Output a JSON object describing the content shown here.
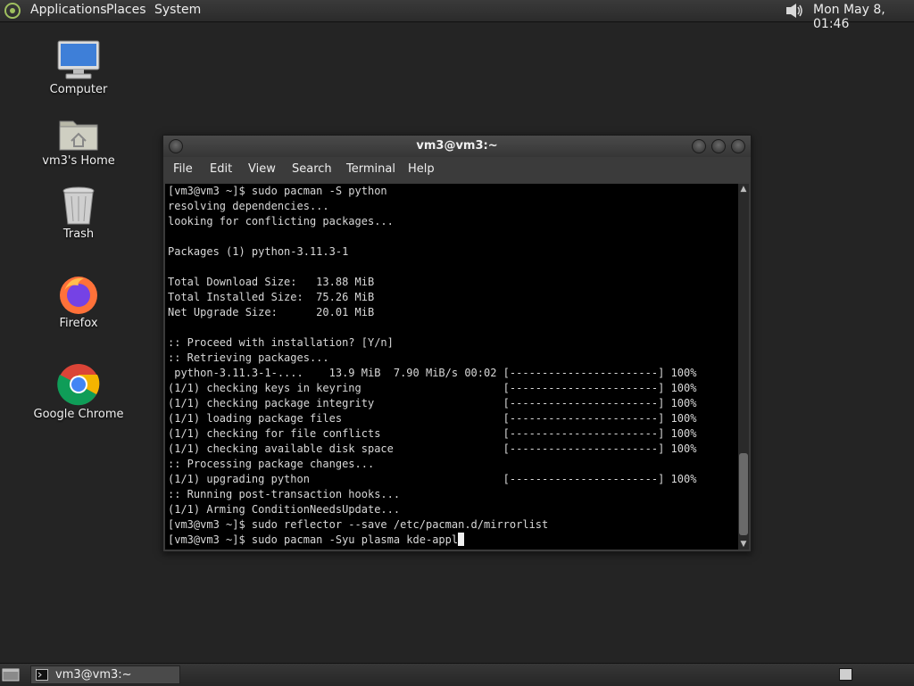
{
  "top_panel": {
    "menus": [
      "Applications",
      "Places",
      "System"
    ],
    "clock": "Mon May  8, 01:46",
    "logo_icon": "distro-logo-icon",
    "volume_icon": "volume-icon"
  },
  "desktop_icons": [
    {
      "label": "Computer",
      "icon": "computer-icon"
    },
    {
      "label": "vm3's Home",
      "icon": "home-folder-icon"
    },
    {
      "label": "Trash",
      "icon": "trash-icon"
    },
    {
      "label": "Firefox",
      "icon": "firefox-icon"
    },
    {
      "label": "Google Chrome",
      "icon": "chrome-icon"
    }
  ],
  "terminal": {
    "title": "vm3@vm3:~",
    "menu": [
      "File",
      "Edit",
      "View",
      "Search",
      "Terminal",
      "Help"
    ],
    "lines": [
      "[vm3@vm3 ~]$ sudo pacman -S python",
      "resolving dependencies...",
      "looking for conflicting packages...",
      "",
      "Packages (1) python-3.11.3-1",
      "",
      "Total Download Size:   13.88 MiB",
      "Total Installed Size:  75.26 MiB",
      "Net Upgrade Size:      20.01 MiB",
      "",
      ":: Proceed with installation? [Y/n]",
      ":: Retrieving packages...",
      " python-3.11.3-1-....    13.9 MiB  7.90 MiB/s 00:02 [-----------------------] 100%",
      "(1/1) checking keys in keyring                      [-----------------------] 100%",
      "(1/1) checking package integrity                    [-----------------------] 100%",
      "(1/1) loading package files                         [-----------------------] 100%",
      "(1/1) checking for file conflicts                   [-----------------------] 100%",
      "(1/1) checking available disk space                 [-----------------------] 100%",
      ":: Processing package changes...",
      "(1/1) upgrading python                              [-----------------------] 100%",
      ":: Running post-transaction hooks...",
      "(1/1) Arming ConditionNeedsUpdate...",
      "[vm3@vm3 ~]$ sudo reflector --save /etc/pacman.d/mirrorlist"
    ],
    "prompt_line": "[vm3@vm3 ~]$ sudo pacman -Syu plasma kde-appl"
  },
  "bottom_panel": {
    "task_label": "vm3@vm3:~",
    "task_icon": "terminal-icon",
    "show_desktop_icon": "show-desktop-icon",
    "workspace_icon": "workspace-switcher-icon"
  }
}
